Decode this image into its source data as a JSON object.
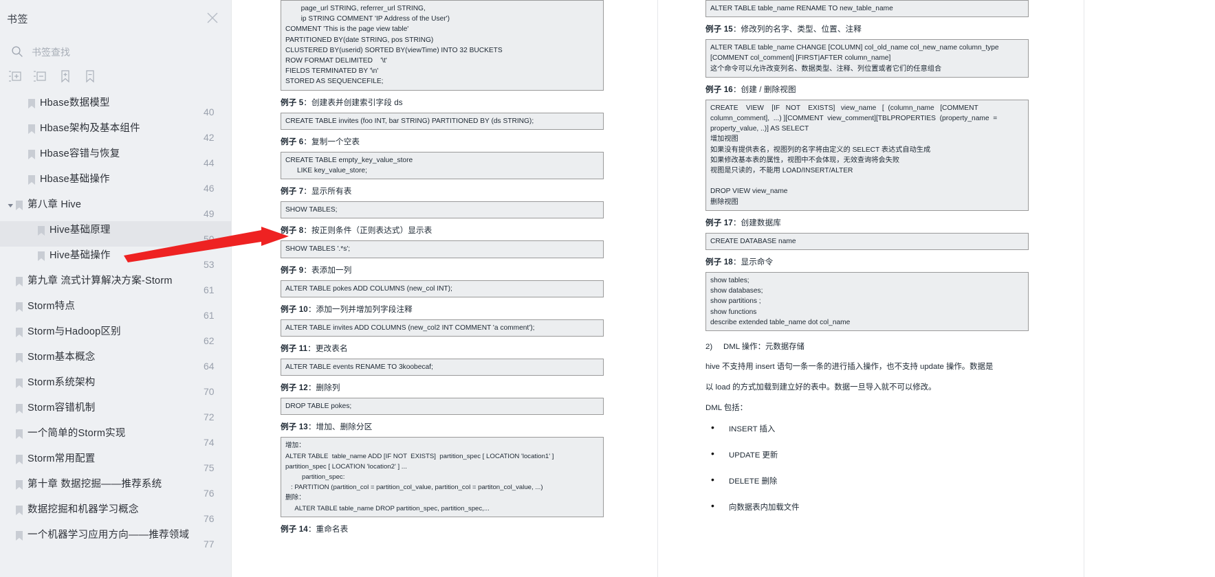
{
  "sidebar": {
    "title": "书签",
    "close_icon": "close-icon",
    "search": {
      "placeholder": "书签查找",
      "value": "",
      "icon": "search-icon"
    },
    "tools": [
      {
        "name": "expand-all-icon",
        "label": "展开全部"
      },
      {
        "name": "collapse-all-icon",
        "label": "收起全部"
      },
      {
        "name": "add-bookmark-icon",
        "label": "添加书签"
      },
      {
        "name": "remove-bookmark-icon",
        "label": "删除书签"
      }
    ],
    "items": [
      {
        "label": "Hbase数据模型",
        "page": "40",
        "level": 1,
        "expandable": false,
        "selected": false
      },
      {
        "label": "Hbase架构及基本组件",
        "page": "42",
        "level": 1,
        "expandable": false,
        "selected": false
      },
      {
        "label": "Hbase容错与恢复",
        "page": "44",
        "level": 1,
        "expandable": false,
        "selected": false
      },
      {
        "label": "Hbase基础操作",
        "page": "46",
        "level": 1,
        "expandable": false,
        "selected": false
      },
      {
        "label": "第八章 Hive",
        "page": "49",
        "level": 0,
        "expandable": true,
        "selected": false
      },
      {
        "label": "Hive基础原理",
        "page": "50",
        "level": 2,
        "expandable": false,
        "selected": true
      },
      {
        "label": "Hive基础操作",
        "page": "53",
        "level": 2,
        "expandable": false,
        "selected": false
      },
      {
        "label": "第九章 流式计算解决方案-Storm",
        "page": "61",
        "level": 0,
        "expandable": false,
        "selected": false
      },
      {
        "label": "Storm特点",
        "page": "61",
        "level": 0,
        "expandable": false,
        "selected": false
      },
      {
        "label": "Storm与Hadoop区别",
        "page": "62",
        "level": 0,
        "expandable": false,
        "selected": false
      },
      {
        "label": "Storm基本概念",
        "page": "64",
        "level": 0,
        "expandable": false,
        "selected": false
      },
      {
        "label": "Storm系统架构",
        "page": "70",
        "level": 0,
        "expandable": false,
        "selected": false
      },
      {
        "label": "Storm容错机制",
        "page": "72",
        "level": 0,
        "expandable": false,
        "selected": false
      },
      {
        "label": "一个简单的Storm实现",
        "page": "74",
        "level": 0,
        "expandable": false,
        "selected": false
      },
      {
        "label": "Storm常用配置",
        "page": "75",
        "level": 0,
        "expandable": false,
        "selected": false
      },
      {
        "label": "第十章 数据挖掘——推荐系统",
        "page": "76",
        "level": 0,
        "expandable": false,
        "selected": false
      },
      {
        "label": "数据挖掘和机器学习概念",
        "page": "76",
        "level": 0,
        "expandable": false,
        "selected": false
      },
      {
        "label": "一个机器学习应用方向——推荐领域",
        "page": "77",
        "level": 0,
        "expandable": false,
        "selected": false
      }
    ]
  },
  "annotation": {
    "arrow_color": "#ee2222",
    "name": "red-arrow-annotation"
  },
  "document": {
    "left_column": [
      {
        "type": "code",
        "text": "        page_url STRING, referrer_url STRING,\n        ip STRING COMMENT 'IP Address of the User')\nCOMMENT 'This is the page view table'\nPARTITIONED BY(date STRING, pos STRING)\nCLUSTERED BY(userid) SORTED BY(viewTime) INTO 32 BUCKETS\nROW FORMAT DELIMITED    '\\t'\nFIELDS TERMINATED BY '\\n'\nSTORED AS SEQUENCEFILE;"
      },
      {
        "type": "heading",
        "num": "例子 5",
        "text": "：创建表并创建索引字段 ds"
      },
      {
        "type": "code",
        "text": "CREATE TABLE invites (foo INT, bar STRING) PARTITIONED BY (ds STRING);"
      },
      {
        "type": "heading",
        "num": "例子 6",
        "text": "：复制一个空表"
      },
      {
        "type": "code",
        "text": "CREATE TABLE empty_key_value_store\n      LIKE key_value_store;"
      },
      {
        "type": "heading",
        "num": "例子 7",
        "text": "：显示所有表"
      },
      {
        "type": "code",
        "text": "SHOW TABLES;"
      },
      {
        "type": "heading",
        "num": "例子 8",
        "text": "：按正则条件（正则表达式）显示表"
      },
      {
        "type": "code",
        "text": "SHOW TABLES '.*s';"
      },
      {
        "type": "heading",
        "num": "例子 9",
        "text": "：表添加一列"
      },
      {
        "type": "code",
        "text": "ALTER TABLE pokes ADD COLUMNS (new_col INT);"
      },
      {
        "type": "heading",
        "num": "例子 10",
        "text": "：添加一列并增加列字段注释"
      },
      {
        "type": "code",
        "text": "ALTER TABLE invites ADD COLUMNS (new_col2 INT COMMENT 'a comment');"
      },
      {
        "type": "heading",
        "num": "例子 11",
        "text": "：更改表名"
      },
      {
        "type": "code",
        "text": "ALTER TABLE events RENAME TO 3koobecaf;"
      },
      {
        "type": "heading",
        "num": "例子 12",
        "text": "：删除列"
      },
      {
        "type": "code",
        "text": "DROP TABLE pokes;"
      },
      {
        "type": "heading",
        "num": "例子 13",
        "text": "：增加、删除分区"
      },
      {
        "type": "code",
        "text": "增加：\nALTER TABLE  table_name ADD [IF NOT  EXISTS]  partition_spec [ LOCATION 'location1' ]\npartition_spec [ LOCATION 'location2' ] ...\n         partition_spec:\n   : PARTITION (partition_col = partition_col_value, partition_col = partiton_col_value, ...)\n删除：\n     ALTER TABLE table_name DROP partition_spec, partition_spec,..."
      },
      {
        "type": "heading",
        "num": "例子 14",
        "text": "：重命名表"
      }
    ],
    "right_column": [
      {
        "type": "code",
        "text": "ALTER TABLE table_name RENAME TO new_table_name"
      },
      {
        "type": "heading",
        "num": "例子 15",
        "text": "：修改列的名字、类型、位置、注释"
      },
      {
        "type": "code",
        "text": "ALTER TABLE table_name CHANGE [COLUMN] col_old_name col_new_name column_type\n[COMMENT col_comment] [FIRST|AFTER column_name]\n这个命令可以允许改变列名、数据类型、注释、列位置或者它们的任意组合"
      },
      {
        "type": "heading",
        "num": "例子 16",
        "text": "：创建 / 删除视图"
      },
      {
        "type": "code",
        "text": "CREATE    VIEW    [IF   NOT    EXISTS]   view_name   [  (column_name   [COMMENT\ncolumn_comment],  ...) ][COMMENT  view_comment][TBLPROPERTIES  (property_name  =\nproperty_value, ..)] AS SELECT\n增加视图\n如果没有提供表名，视图列的名字将由定义的 SELECT 表达式自动生成\n如果修改基本表的属性，视图中不会体现，无效查询将会失败\n视图是只读的，不能用 LOAD/INSERT/ALTER\n\nDROP VIEW view_name\n删除视图"
      },
      {
        "type": "heading",
        "num": "例子 17",
        "text": "：创建数据库"
      },
      {
        "type": "code",
        "text": "CREATE DATABASE name"
      },
      {
        "type": "heading",
        "num": "例子 18",
        "text": "：显示命令"
      },
      {
        "type": "code",
        "text": "show tables;\nshow databases;\nshow partitions ;\nshow functions\ndescribe extended table_name dot col_name"
      },
      {
        "type": "numbered",
        "num": "2)",
        "text": "DML 操作：元数据存储"
      },
      {
        "type": "para",
        "text": "hive 不支持用 insert 语句一条一条的进行插入操作，也不支持 update 操作。数据是"
      },
      {
        "type": "para",
        "text": "以 load 的方式加载到建立好的表中。数据一旦导入就不可以修改。"
      },
      {
        "type": "para",
        "text": "DML 包括："
      },
      {
        "type": "bullet",
        "text": "INSERT 插入"
      },
      {
        "type": "bullet",
        "text": "UPDATE 更新"
      },
      {
        "type": "bullet",
        "text": "DELETE 删除"
      },
      {
        "type": "bullet",
        "text": "向数据表内加载文件"
      }
    ]
  }
}
